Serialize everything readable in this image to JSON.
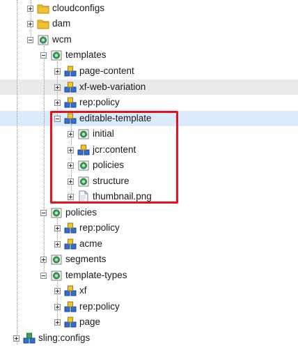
{
  "tree": {
    "nodes": [
      {
        "id": "cloudconfigs",
        "label": "cloudconfigs",
        "icon": "folder-icon",
        "expander": "plus"
      },
      {
        "id": "dam",
        "label": "dam",
        "icon": "folder-icon",
        "expander": "plus"
      },
      {
        "id": "wcm",
        "label": "wcm",
        "icon": "node-icon",
        "expander": "minus"
      },
      {
        "id": "templates",
        "label": "templates",
        "icon": "node-icon",
        "expander": "minus"
      },
      {
        "id": "page-content",
        "label": "page-content",
        "icon": "cube-icon",
        "expander": "plus"
      },
      {
        "id": "xf-web-variation",
        "label": "xf-web-variation",
        "icon": "cube-icon",
        "expander": "plus",
        "state": "hover"
      },
      {
        "id": "rep-policy-templates",
        "label": "rep:policy",
        "icon": "cube-icon",
        "expander": "plus"
      },
      {
        "id": "editable-template",
        "label": "editable-template",
        "icon": "cube-icon",
        "expander": "minus",
        "state": "selected"
      },
      {
        "id": "initial",
        "label": "initial",
        "icon": "node-icon",
        "expander": "plus"
      },
      {
        "id": "jcr-content",
        "label": "jcr:content",
        "icon": "cube-icon",
        "expander": "plus"
      },
      {
        "id": "policies-et",
        "label": "policies",
        "icon": "node-icon",
        "expander": "plus"
      },
      {
        "id": "structure",
        "label": "structure",
        "icon": "node-icon",
        "expander": "plus"
      },
      {
        "id": "thumbnail",
        "label": "thumbnail.png",
        "icon": "file-icon",
        "expander": "plus"
      },
      {
        "id": "policies",
        "label": "policies",
        "icon": "node-icon",
        "expander": "minus"
      },
      {
        "id": "rep-policy-policies",
        "label": "rep:policy",
        "icon": "cube-icon",
        "expander": "plus"
      },
      {
        "id": "acme",
        "label": "acme",
        "icon": "cube-icon",
        "expander": "plus"
      },
      {
        "id": "segments",
        "label": "segments",
        "icon": "node-icon",
        "expander": "plus"
      },
      {
        "id": "template-types",
        "label": "template-types",
        "icon": "node-icon",
        "expander": "minus"
      },
      {
        "id": "xf",
        "label": "xf",
        "icon": "cube-icon",
        "expander": "plus"
      },
      {
        "id": "rep-policy-tt",
        "label": "rep:policy",
        "icon": "cube-icon",
        "expander": "plus"
      },
      {
        "id": "page",
        "label": "page",
        "icon": "cube-icon",
        "expander": "plus"
      },
      {
        "id": "sling-configs",
        "label": "sling:configs",
        "icon": "cube-icon",
        "expander": "plus"
      }
    ]
  },
  "annotation": {
    "color": "#e8101b"
  }
}
